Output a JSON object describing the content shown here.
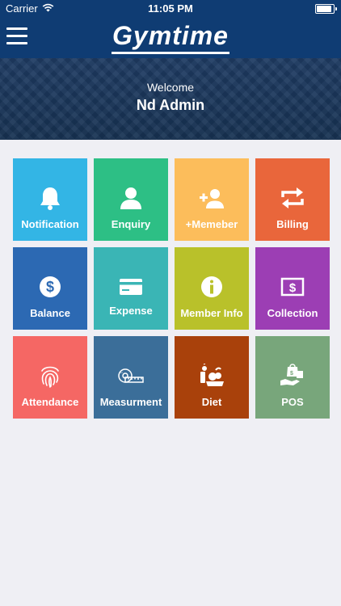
{
  "status_bar": {
    "carrier": "Carrier",
    "time": "11:05 PM"
  },
  "app": {
    "logo": "Gymtime"
  },
  "welcome": {
    "greeting": "Welcome",
    "user": "Nd Admin"
  },
  "tiles": [
    {
      "label": "Notification",
      "icon": "bell-icon",
      "color": "#33b5e5"
    },
    {
      "label": "Enquiry",
      "icon": "user-icon",
      "color": "#2dbf85"
    },
    {
      "label": "+Memeber",
      "icon": "person-add-icon",
      "color": "#fcbd5b"
    },
    {
      "label": "Billing",
      "icon": "repeat-icon",
      "color": "#e9663b"
    },
    {
      "label": "Balance",
      "icon": "dollar-icon",
      "color": "#2c69b3"
    },
    {
      "label": "Expense",
      "icon": "card-icon",
      "color": "#3ab5b5"
    },
    {
      "label": "Member Info",
      "icon": "info-icon",
      "color": "#b9c12a"
    },
    {
      "label": "Collection",
      "icon": "cash-icon",
      "color": "#9c3eb4"
    },
    {
      "label": "Attendance",
      "icon": "fingerprint-icon",
      "color": "#f56764"
    },
    {
      "label": "Measurment",
      "icon": "tape-measure-icon",
      "color": "#3b6e99"
    },
    {
      "label": "Diet",
      "icon": "food-icon",
      "color": "#a9410b"
    },
    {
      "label": "POS",
      "icon": "shopping-bag-icon",
      "color": "#78a67b"
    }
  ]
}
